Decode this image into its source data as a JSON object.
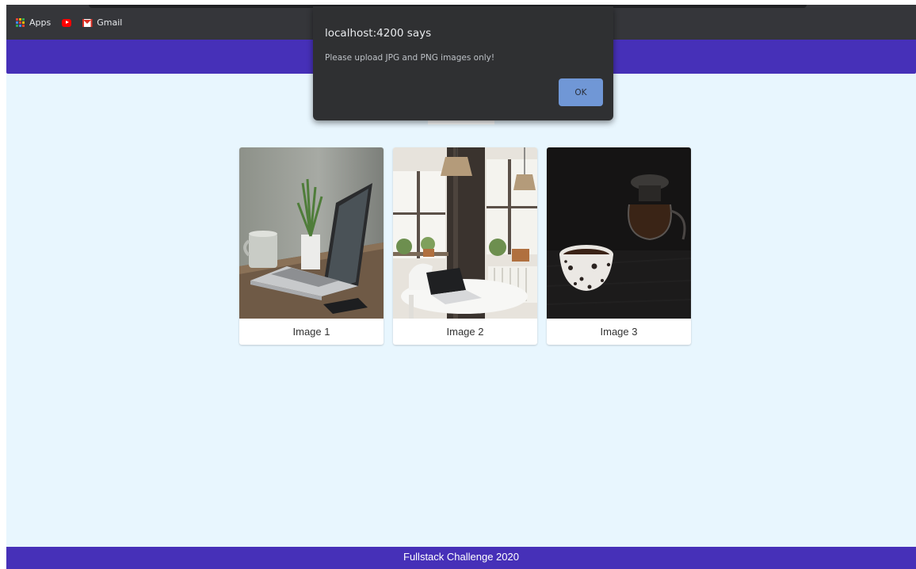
{
  "browser": {
    "bookmarks": [
      {
        "label": "Apps",
        "icon": "apps-grid-icon"
      },
      {
        "label": "",
        "icon": "youtube-icon"
      },
      {
        "label": "Gmail",
        "icon": "gmail-icon"
      }
    ]
  },
  "alert": {
    "title": "localhost:4200 says",
    "message": "Please upload JPG and PNG images only!",
    "ok_label": "OK"
  },
  "gallery": {
    "images": [
      {
        "caption": "Image 1"
      },
      {
        "caption": "Image 2"
      },
      {
        "caption": "Image 3"
      }
    ]
  },
  "footer": {
    "text": "Fullstack Challenge 2020"
  },
  "colors": {
    "header": "#4630b8",
    "background": "#e8f6fe",
    "alert_bg": "#2f3032",
    "ok_button": "#7097d6"
  }
}
